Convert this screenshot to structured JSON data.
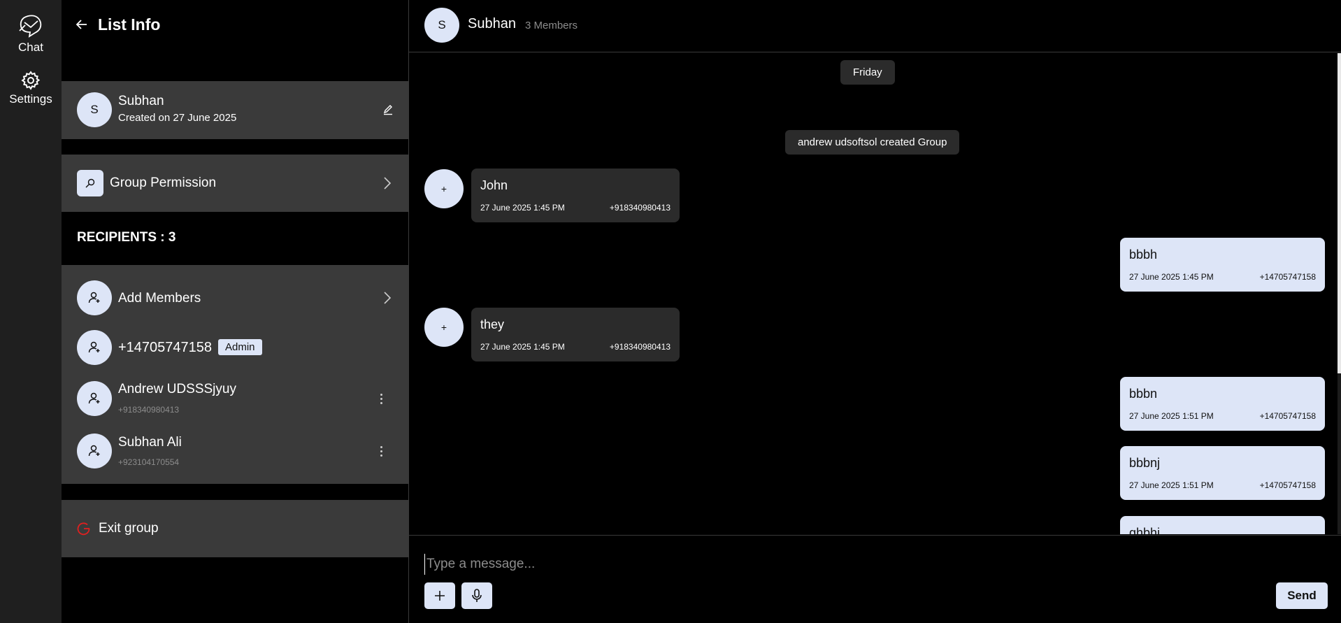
{
  "rail": {
    "items": [
      {
        "label": "Chat",
        "icon": "chat-icon"
      },
      {
        "label": "Settings",
        "icon": "gear-icon"
      }
    ]
  },
  "panel": {
    "title": "List Info",
    "group": {
      "initial": "S",
      "name": "Subhan",
      "created": "Created on 27 June 2025"
    },
    "permission_label": "Group Permission",
    "recipients_label": "RECIPIENTS : 3",
    "add_members_label": "Add Members",
    "members": [
      {
        "name": "+14705747158",
        "badge": "Admin",
        "phone": ""
      },
      {
        "name": "Andrew UDSSSjyuy",
        "badge": "",
        "phone": "+918340980413"
      },
      {
        "name": "Subhan Ali",
        "badge": "",
        "phone": "+923104170554"
      }
    ],
    "exit_label": "Exit group"
  },
  "chat": {
    "header": {
      "initial": "S",
      "name": "Subhan",
      "members": "3 Members"
    },
    "date_label": "Friday",
    "system_message": "andrew udsoftsol created Group",
    "messages": [
      {
        "dir": "in",
        "avatar": "+",
        "text": "John",
        "time": "27 June 2025 1:45 PM",
        "number": "+918340980413"
      },
      {
        "dir": "out",
        "text": "bbbh",
        "time": "27 June 2025 1:45 PM",
        "number": "+14705747158"
      },
      {
        "dir": "in",
        "avatar": "+",
        "text": "they",
        "time": "27 June 2025 1:45 PM",
        "number": "+918340980413"
      },
      {
        "dir": "out",
        "text": "bbbn",
        "time": "27 June 2025 1:51 PM",
        "number": "+14705747158"
      },
      {
        "dir": "out",
        "text": "bbbnj",
        "time": "27 June 2025 1:51 PM",
        "number": "+14705747158"
      },
      {
        "dir": "out",
        "text": "ghbhj",
        "time": "",
        "number": ""
      }
    ],
    "composer": {
      "placeholder": "Type a message...",
      "send_label": "Send"
    }
  },
  "colors": {
    "accent": "#dde5f7",
    "panel_block": "#3a3a3a",
    "bubble_in": "#2b2b2b",
    "exit_icon": "#e02020"
  }
}
